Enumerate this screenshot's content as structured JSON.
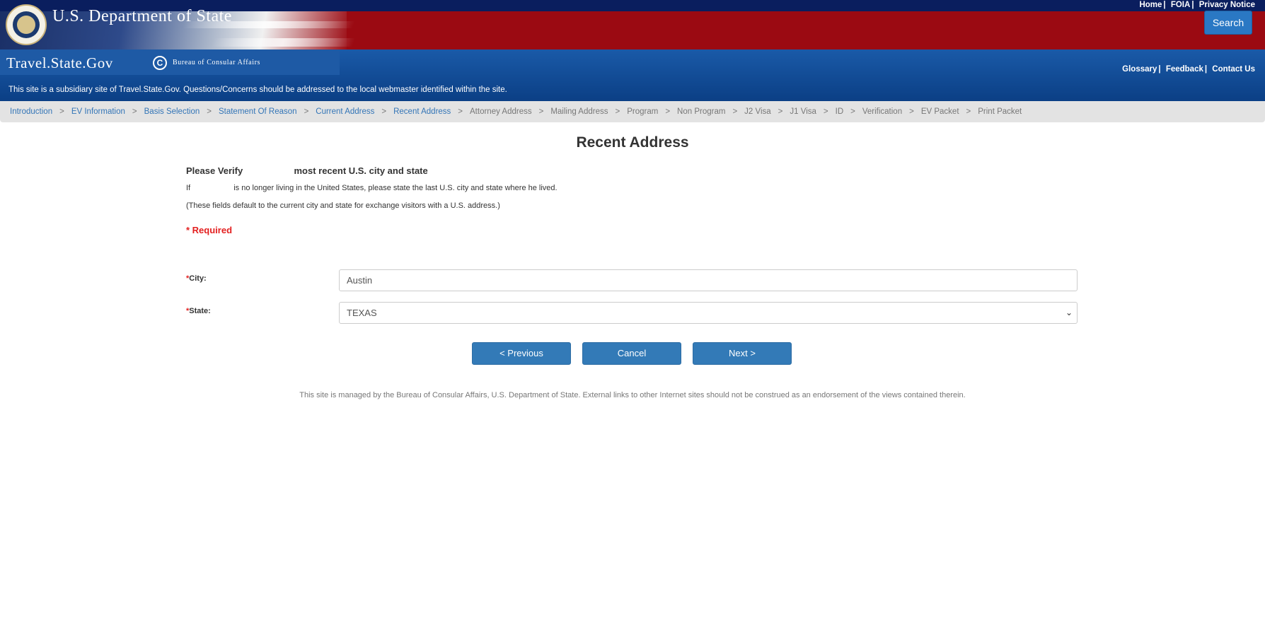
{
  "header": {
    "top_links": [
      "Home",
      "FOIA",
      "Privacy Notice"
    ],
    "department_title": "U.S. Department of State",
    "search_label": "Search",
    "site_name": "Travel.State.Gov",
    "bureau_name": "Bureau of Consular Affairs",
    "right_links": [
      "Glossary",
      "Feedback",
      "Contact Us"
    ],
    "subsidiary_notice": "This site is a subsidiary site of Travel.State.Gov. Questions/Concerns should be addressed to the local webmaster identified within the site."
  },
  "breadcrumb": {
    "separator": ">",
    "items": [
      {
        "label": "Introduction",
        "link": true
      },
      {
        "label": "EV Information",
        "link": true
      },
      {
        "label": "Basis Selection",
        "link": true
      },
      {
        "label": "Statement Of Reason",
        "link": true
      },
      {
        "label": "Current Address",
        "link": true
      },
      {
        "label": "Recent Address",
        "link": true
      },
      {
        "label": "Attorney Address",
        "link": false
      },
      {
        "label": "Mailing Address",
        "link": false
      },
      {
        "label": "Program",
        "link": false
      },
      {
        "label": "Non Program",
        "link": false
      },
      {
        "label": "J2 Visa",
        "link": false
      },
      {
        "label": "J1 Visa",
        "link": false
      },
      {
        "label": "ID",
        "link": false
      },
      {
        "label": "Verification",
        "link": false
      },
      {
        "label": "EV Packet",
        "link": false
      },
      {
        "label": "Print Packet",
        "link": false
      }
    ]
  },
  "main": {
    "title": "Recent Address",
    "verify_heading": "Please Verify                    most recent U.S. city and state",
    "note_living": "If                    is no longer living in the United States, please state the last U.S. city and state where he lived.",
    "note_default": "(These fields default to the current city and state for exchange visitors with a U.S. address.)",
    "required_label": "* Required",
    "required_star": "*",
    "city_label": "City:",
    "city_value": "Austin",
    "state_label": "State:",
    "state_value": "TEXAS"
  },
  "buttons": {
    "previous": "< Previous",
    "cancel": "Cancel",
    "next": "Next >"
  },
  "footer": {
    "text": "This site is managed by the Bureau of Consular Affairs, U.S. Department of State. External links to other Internet sites should not be construed as an endorsement of the views contained therein."
  },
  "colors": {
    "navy": "#0a1e5e",
    "red": "#9b0a12",
    "blue": "#1a5aa8",
    "link": "#3375b7",
    "button": "#337ab7",
    "required": "#e32020"
  },
  "icons": [
    "state-department-seal-icon",
    "consular-affairs-c-icon",
    "chevron-down-icon"
  ]
}
